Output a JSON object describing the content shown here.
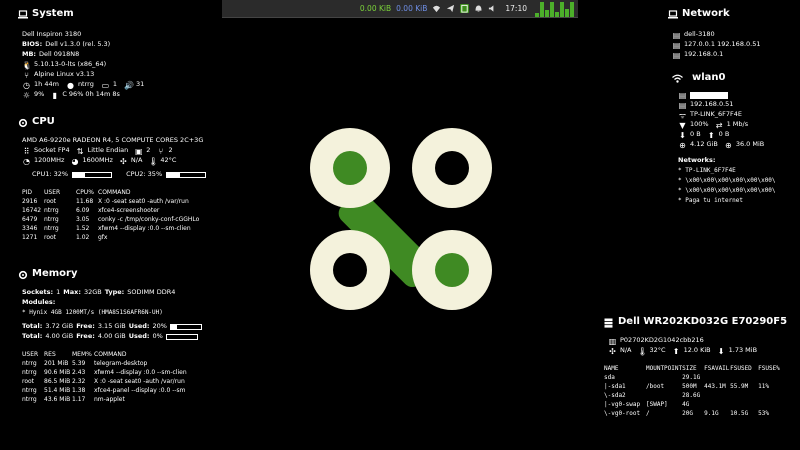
{
  "topbar": {
    "net_down": "0.00 KiB",
    "net_up": "0.00 KiB",
    "clock": "17:10",
    "tray_icons": [
      "wifi-icon",
      "telegram-icon",
      "clipboard-icon",
      "bell-icon",
      "volume-icon"
    ],
    "graph_levels": [
      0.2,
      0.9,
      0.4,
      0.9,
      0.3,
      0.9,
      0.5,
      0.9
    ],
    "accent": "#4caf2a"
  },
  "system": {
    "title": "System",
    "model": "Dell Inspiron 3180",
    "bios_label": "BIOS:",
    "bios": "Dell v1.3.0 (rel. 5.3)",
    "mb_label": "MB:",
    "mb": "Dell 0918N8",
    "kernel": "5.10.13-0-lts (x86_64)",
    "distro": "Alpine Linux v3.13",
    "uptime": "1h 44m",
    "user": "ntrrg",
    "screens": "1",
    "volume": "31",
    "brightness": "9%",
    "battery": "C 96% 0h 14m 8s"
  },
  "cpu": {
    "title": "CPU",
    "model": "AMD A6-9220e RADEON R4, 5 COMPUTE CORES 2C+3G",
    "socket": "Socket FP4",
    "endian": "Little Endian",
    "cores": "2",
    "threads": "2",
    "freq_cur": "1200MHz",
    "freq_max": "1600MHz",
    "fan": "N/A",
    "temp": "42°C",
    "cpu1_label": "CPU1: 32%",
    "cpu1_value": 0.32,
    "cpu2_label": "CPU2: 35%",
    "cpu2_value": 0.35,
    "columns": [
      "PID",
      "USER",
      "CPU%",
      "COMMAND"
    ],
    "processes": [
      [
        "2916",
        "root",
        "11.68",
        "X :0 -seat seat0 -auth /var/run"
      ],
      [
        "16742",
        "ntrrg",
        "6.09",
        "xfce4-screenshooter"
      ],
      [
        "6479",
        "ntrrg",
        "3.05",
        "conky -c /tmp/conky-conf-cGGHLo"
      ],
      [
        "3346",
        "ntrrg",
        "1.52",
        "xfwm4 --display :0.0 --sm-clien"
      ],
      [
        "1271",
        "root",
        "1.02",
        "gfx"
      ]
    ]
  },
  "memory": {
    "title": "Memory",
    "sockets_label": "Sockets:",
    "sockets": "1",
    "max_label": "Max:",
    "max": "32GB",
    "type_label": "Type:",
    "type": "SODIMM DDR4",
    "modules_label": "Modules:",
    "module": "* Hynix 4GB 1200MT/s (HMA851S6AFR6N-UH)",
    "ram_total_label": "Total:",
    "ram_total": "3.72 GiB",
    "ram_free_label": "Free:",
    "ram_free": "3.15 GiB",
    "ram_used_label": "Used:",
    "ram_used": "20%",
    "ram_used_value": 0.2,
    "swap_total_label": "Total:",
    "swap_total": "4.00 GiB",
    "swap_free_label": "Free:",
    "swap_free": "4.00 GiB",
    "swap_used_label": "Used:",
    "swap_used": "0%",
    "swap_used_value": 0.0,
    "columns": [
      "USER",
      "RES",
      "MEM%",
      "COMMAND"
    ],
    "processes": [
      [
        "ntrrg",
        "201 MiB",
        "5.39",
        "telegram-desktop"
      ],
      [
        "ntrrg",
        "90.6 MiB",
        "2.43",
        "xfwm4 --display :0.0 --sm-clien"
      ],
      [
        "root",
        "86.5 MiB",
        "2.32",
        "X :0 -seat seat0 -auth /var/run"
      ],
      [
        "ntrrg",
        "51.4 MiB",
        "1.38",
        "xfce4-panel --display :0.0 --sm"
      ],
      [
        "ntrrg",
        "43.6 MiB",
        "1.17",
        "nm-applet"
      ]
    ]
  },
  "network": {
    "title": "Network",
    "hostname": "dell-3180",
    "local_ips": "127.0.0.1 192.168.0.51",
    "gateway": "192.168.0.1"
  },
  "wlan": {
    "title": "wlan0",
    "mac_redacted": "",
    "ip": "192.168.0.51",
    "ssid": "TP-LINK_6F7F4E",
    "signal": "100%",
    "bitrate": "1 Mb/s",
    "down_rate": "0 B",
    "up_rate": "0 B",
    "total_down": "4.12 GiB",
    "total_up": "36.0 MiB",
    "networks_label": "Networks:",
    "networks": [
      "* TP-LINK_6F7F4E",
      "* \\x00\\x00\\x00\\x00\\x00\\x00\\",
      "* \\x00\\x00\\x00\\x00\\x00\\x00\\",
      "* Paga tu internet"
    ]
  },
  "disk": {
    "title": "Dell WR202KD032G E70290F5",
    "serial": "P02702KD2G1042cbb216",
    "fan": "N/A",
    "temp": "32°C",
    "read": "12.0 KiB",
    "write": "1.73 MiB",
    "columns": [
      "NAME",
      "MOUNTPOINT",
      "SIZE",
      "FSAVAIL",
      "FSUSED",
      "FSUSE%"
    ],
    "rows": [
      [
        "sda",
        "",
        "29.1G",
        "",
        "",
        ""
      ],
      [
        "|-sda1",
        "/boot",
        "500M",
        "443.1M",
        "55.9M",
        "11%"
      ],
      [
        "\\-sda2",
        "",
        "28.6G",
        "",
        "",
        ""
      ],
      [
        "  |-vg0-swap",
        "[SWAP]",
        "4G",
        "",
        "",
        ""
      ],
      [
        "  \\-vg0-root",
        "/",
        "20G",
        "9.1G",
        "10.5G",
        "53%"
      ]
    ]
  },
  "logo": {
    "ring_color": "#f4f2dc",
    "accent_color": "#3f8a23"
  }
}
